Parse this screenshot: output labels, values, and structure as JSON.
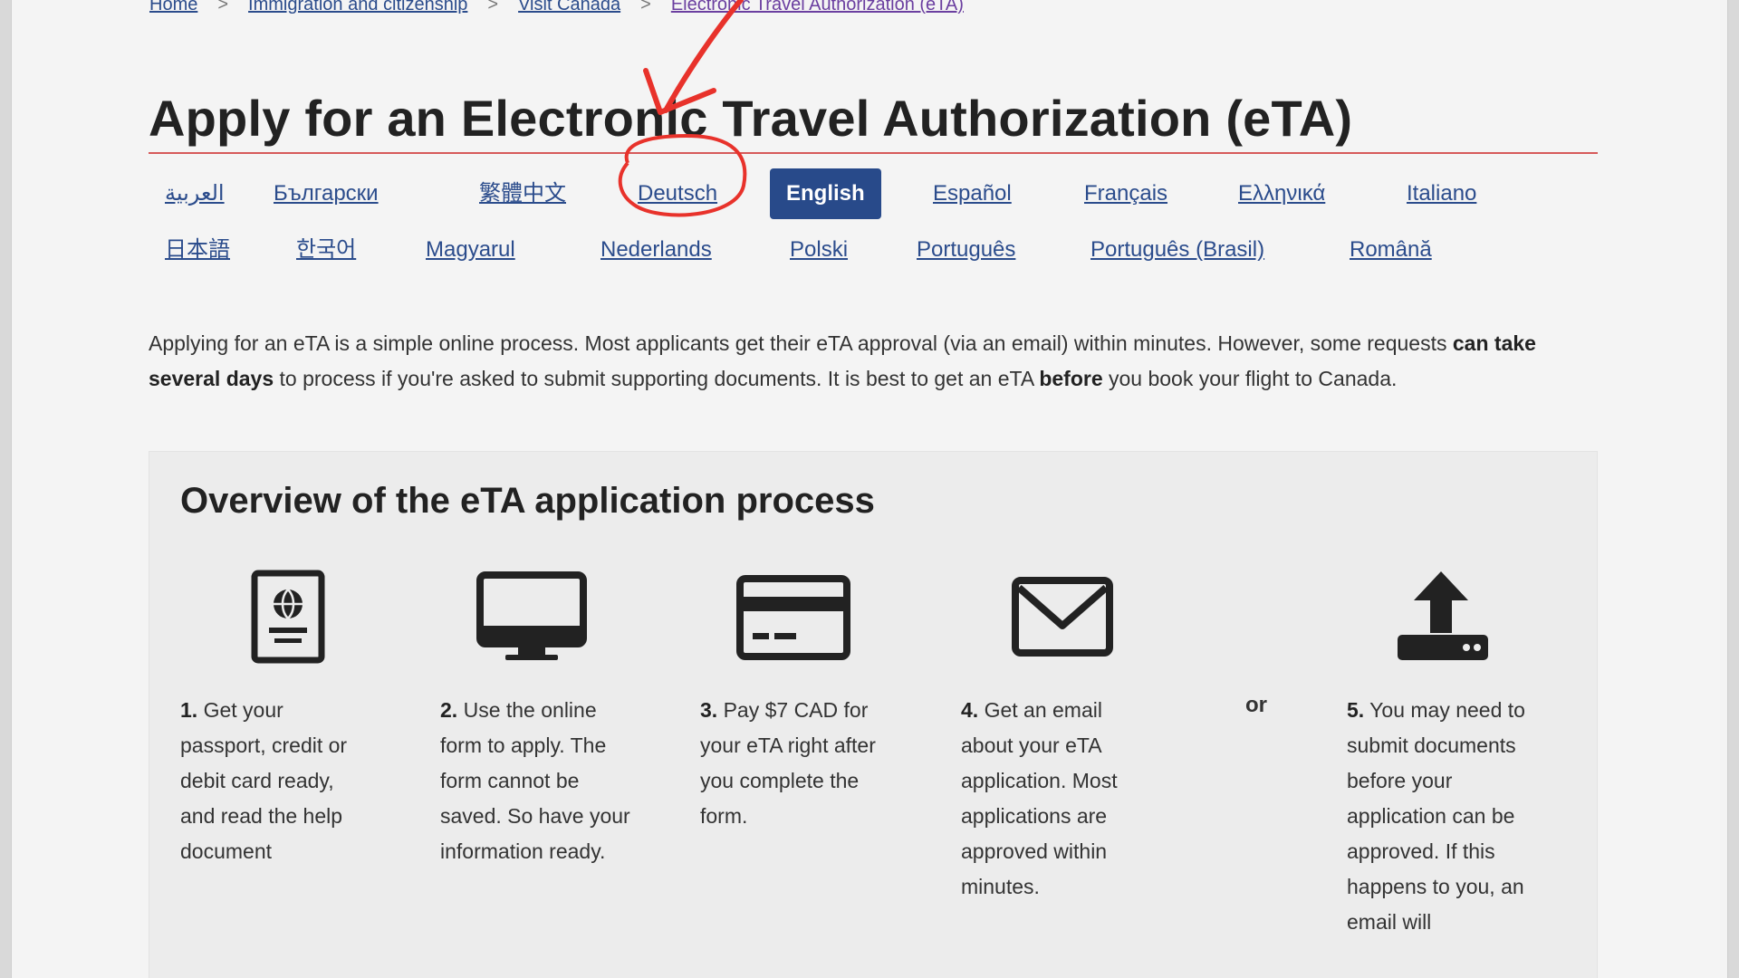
{
  "breadcrumb": {
    "items": [
      "Home",
      "Immigration and citizenship",
      "Visit Canada",
      "Electronic Travel Authorization (eTA)"
    ],
    "separator": ">"
  },
  "page": {
    "title": "Apply for an Electronic Travel Authorization (eTA)"
  },
  "languages": {
    "row1": [
      "العربية",
      "Български",
      "繁體中文",
      "Deutsch",
      "English",
      "Español",
      "Français",
      "Ελληνικά",
      "Italiano"
    ],
    "row2": [
      "日本語",
      "한국어",
      "Magyarul",
      "Nederlands",
      "Polski",
      "Português",
      "Português (Brasil)",
      "Română"
    ],
    "active": "English"
  },
  "intro": {
    "part1": "Applying for an eTA is a simple online process. Most applicants get their eTA approval (via an email) within minutes. However, some requests ",
    "bold1": "can take several days",
    "part2": " to process if you're asked to submit supporting documents. It is best to get an eTA ",
    "bold2": "before",
    "part3": " you book your flight to Canada."
  },
  "overview": {
    "title": "Overview of the eTA application process",
    "or_label": "or",
    "steps": [
      {
        "num": "1.",
        "text": "Get your passport, credit or debit card ready, and read the help document",
        "icon": "passport-icon"
      },
      {
        "num": "2.",
        "text": "Use the online form to apply. The form cannot be saved. So have your information ready.",
        "icon": "computer-monitor-icon"
      },
      {
        "num": "3.",
        "text": "Pay $7 CAD for your eTA right after you complete the form.",
        "icon": "credit-card-icon"
      },
      {
        "num": "4.",
        "text": "Get an email about your eTA application. Most applications are approved within minutes.",
        "icon": "envelope-icon"
      },
      {
        "num": "5.",
        "text": "You may need to submit documents before your application can be approved. If this happens to you, an email will",
        "icon": "upload-icon"
      }
    ]
  },
  "colors": {
    "link": "#2b4c8c",
    "active_language_bg": "#284a8a",
    "title_rule": "#d65a5a",
    "annotation": "#e8322b"
  }
}
